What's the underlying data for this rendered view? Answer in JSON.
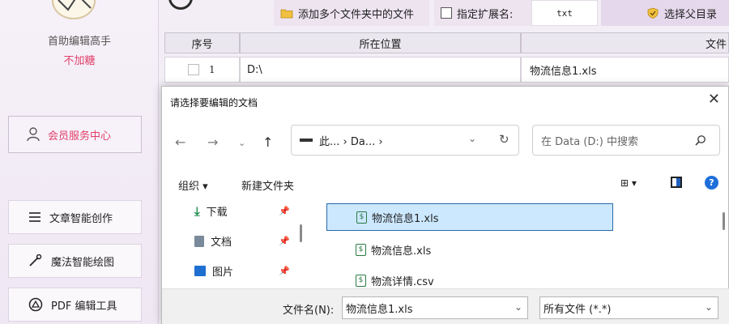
{
  "sidebar": {
    "app_name": "首助编辑高手",
    "app_sub": "不加糖",
    "member_label": "会员服务中心",
    "nav": [
      {
        "label": "文章智能创作",
        "icon": "menu-lines-icon"
      },
      {
        "label": "魔法智能绘图",
        "icon": "magic-wand-icon"
      },
      {
        "label": "PDF 编辑工具",
        "icon": "pdf-tool-icon"
      }
    ]
  },
  "toolbar": {
    "add_folders_label": "添加多个文件夹中的文件",
    "ext_label": "指定扩展名:",
    "ext_value": "txt",
    "parent_dir_label": "选择父目录"
  },
  "table": {
    "headers": [
      "序号",
      "所在位置",
      "文件"
    ],
    "rows": [
      {
        "index": "1",
        "location": "D:\\",
        "filename": "物流信息1.xls"
      }
    ]
  },
  "dialog": {
    "title": "请选择要编辑的文档",
    "breadcrumb": "此... › Da... ›",
    "search_placeholder": "在 Data (D:) 中搜索",
    "organize_label": "组织 ▾",
    "new_folder_label": "新建文件夹",
    "quick_access": [
      {
        "label": "下载",
        "icon": "download-icon"
      },
      {
        "label": "文档",
        "icon": "document-icon"
      },
      {
        "label": "图片",
        "icon": "picture-icon"
      }
    ],
    "files": [
      "物流信息1.xls",
      "物流信息.xls",
      "物流详情.csv"
    ],
    "filename_label": "文件名(N):",
    "filename_value": "物流信息1.xls",
    "filetype_value": "所有文件 (*.*)"
  },
  "colors": {
    "accent_pink": "#e0406a",
    "selection_blue": "#cce8ff"
  }
}
